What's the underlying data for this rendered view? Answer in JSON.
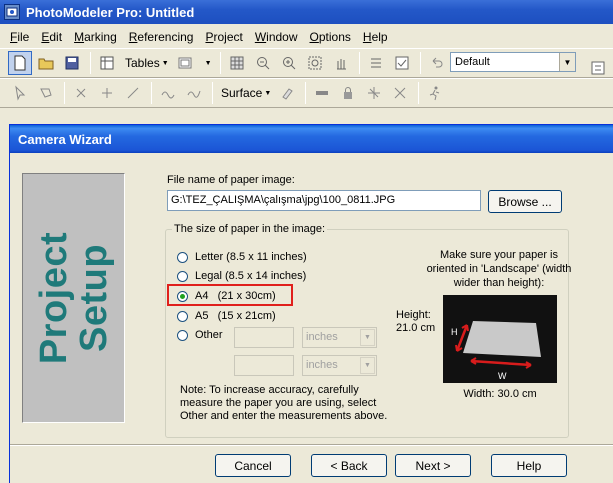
{
  "app": {
    "title": "PhotoModeler Pro: Untitled"
  },
  "menu": [
    {
      "pre": "",
      "u": "F",
      "post": "ile"
    },
    {
      "pre": "",
      "u": "E",
      "post": "dit"
    },
    {
      "pre": "",
      "u": "M",
      "post": "arking"
    },
    {
      "pre": "",
      "u": "R",
      "post": "eferencing"
    },
    {
      "pre": "",
      "u": "P",
      "post": "roject"
    },
    {
      "pre": "",
      "u": "W",
      "post": "indow"
    },
    {
      "pre": "",
      "u": "O",
      "post": "ptions"
    },
    {
      "pre": "",
      "u": "H",
      "post": "elp"
    }
  ],
  "toolbar": {
    "tables_label": "Tables",
    "surface_label": "Surface",
    "style_combo_value": "Default"
  },
  "wizard": {
    "title": "Camera Wizard",
    "side_text_line1": "Project",
    "side_text_line2": "Setup",
    "file_label": "File name of paper image:",
    "file_value": "G:\\TEZ_ÇALIŞMA\\çalışma\\jpg\\100_0811.JPG",
    "browse_label": "Browse ...",
    "group_label": "The size of paper in the image:",
    "options": [
      {
        "label": "Letter (8.5 x 11 inches)",
        "checked": false
      },
      {
        "label": "Legal (8.5 x 14 inches)",
        "checked": false
      },
      {
        "label": "A4   (21 x 30cm)",
        "checked": true
      },
      {
        "label": "A5   (15 x 21cm)",
        "checked": false
      },
      {
        "label": "Other",
        "checked": false
      }
    ],
    "unit_placeholder_1": "inches",
    "unit_placeholder_2": "inches",
    "landscape_note": "Make sure your paper is oriented in 'Landscape' (width wider than height):",
    "height_label": "Height: 21.0 cm",
    "width_label": "Width: 30.0 cm",
    "photo_h_label": "H",
    "photo_w_label": "W",
    "bottom_note": "Note: To increase accuracy, carefully measure the paper you are using, select Other and enter the measurements above.",
    "cancel_label": "Cancel",
    "back_label": "< Back",
    "next_label": "Next >",
    "help_label": "Help"
  }
}
